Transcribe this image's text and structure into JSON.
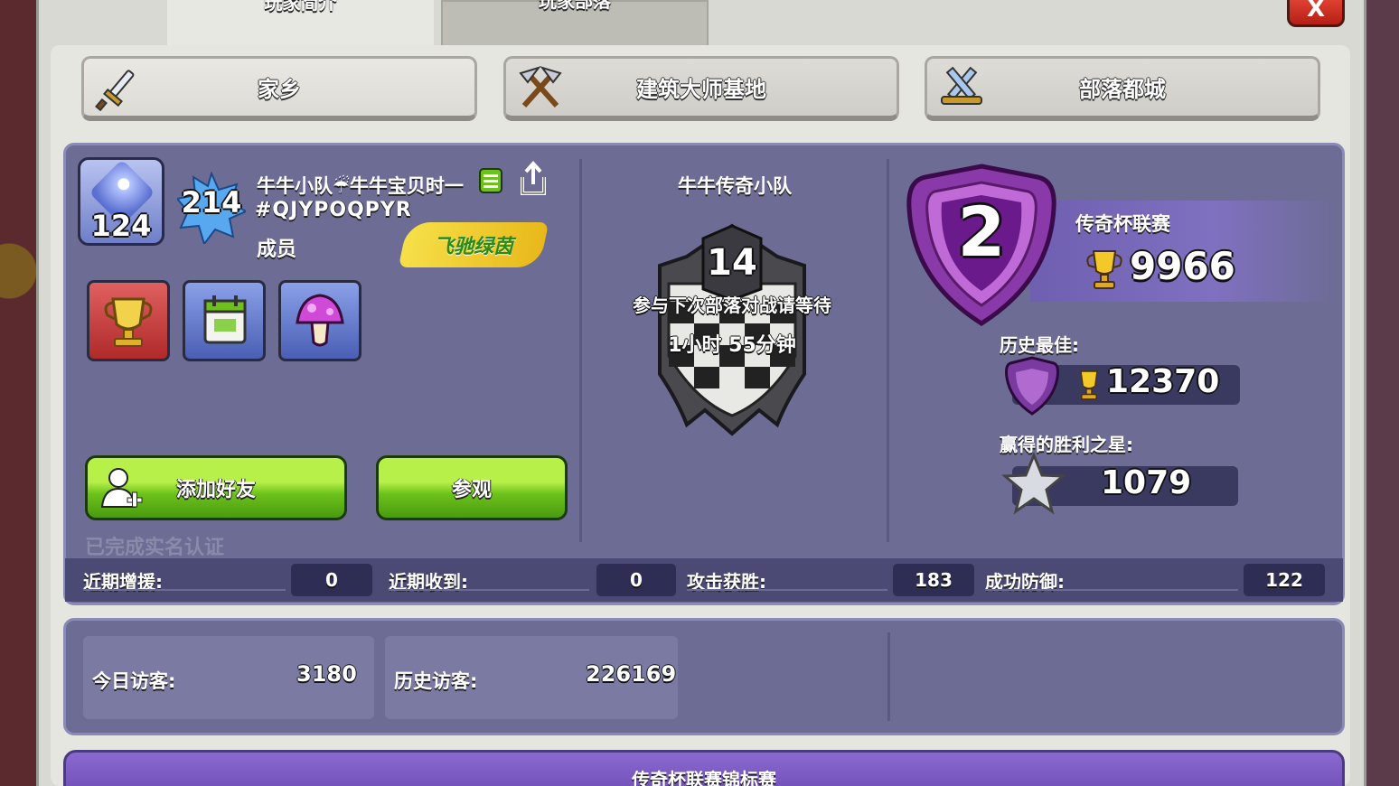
{
  "top_tabs": {
    "intro_label": "玩家简介",
    "clan_label": "玩家部落"
  },
  "close_label": "X",
  "village_tabs": [
    {
      "label": "家乡",
      "icon": "sword-icon",
      "active": true
    },
    {
      "label": "建筑大师基地",
      "icon": "crossed-hammers-icon",
      "active": false
    },
    {
      "label": "部落都城",
      "icon": "crossed-swords-icon",
      "active": false
    }
  ],
  "player": {
    "xp_level": "124",
    "town_level": "214",
    "name": "牛牛小队☔牛牛宝贝时一",
    "tag": "#QJYPOQPYR",
    "role": "成员",
    "clan_label_badge": "飞驰绿茵",
    "achievements": [
      "trophy-icon",
      "calendar-icon",
      "mushroom-icon"
    ]
  },
  "actions": {
    "add_friend": "添加好友",
    "visit": "参观"
  },
  "verified_text": "已完成实名认证",
  "clan": {
    "name": "牛牛传奇小队",
    "level": "14",
    "war_status": "参与下次部落对战请等待",
    "war_time": "1小时 55分钟"
  },
  "league": {
    "rank": "2",
    "name": "传奇杯联赛",
    "trophies": "9966",
    "best_label": "历史最佳:",
    "best_trophies": "12370",
    "stars_label": "赢得的胜利之星:",
    "stars": "1079"
  },
  "stats": [
    {
      "label": "近期增援:",
      "value": "0"
    },
    {
      "label": "近期收到:",
      "value": "0"
    },
    {
      "label": "攻击获胜:",
      "value": "183"
    },
    {
      "label": "成功防御:",
      "value": "122"
    }
  ],
  "visitors": {
    "today_label": "今日访客:",
    "today_value": "3180",
    "total_label": "历史访客:",
    "total_value": "226169"
  },
  "legend_tournament": "传奇杯联赛锦标赛",
  "colors": {
    "panel": "#6c6c94",
    "button_green": "#6cc21a",
    "close_red": "#d8352a",
    "league_purple": "#8a6ad0"
  }
}
